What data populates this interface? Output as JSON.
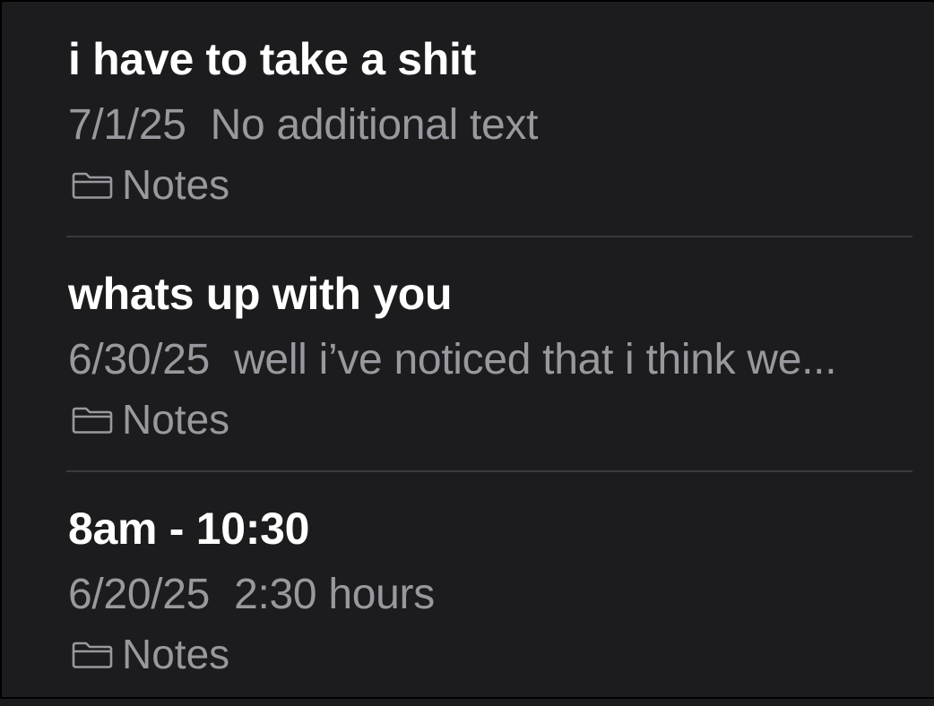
{
  "notes": [
    {
      "title": "i have to take a shit",
      "date": "7/1/25",
      "preview": "No additional text",
      "folder": "Notes",
      "folder_icon": "folder-icon"
    },
    {
      "title": "whats up with you",
      "date": "6/30/25",
      "preview": "well i’ve noticed that i think we...",
      "folder": "Notes",
      "folder_icon": "folder-icon"
    },
    {
      "title": "8am - 10:30",
      "date": "6/20/25",
      "preview": "2:30 hours",
      "folder": "Notes",
      "folder_icon": "folder-icon"
    }
  ],
  "colors": {
    "background": "#1c1c1e",
    "title_text": "#ffffff",
    "secondary_text": "#98989f",
    "divider": "#3a3a3d"
  }
}
